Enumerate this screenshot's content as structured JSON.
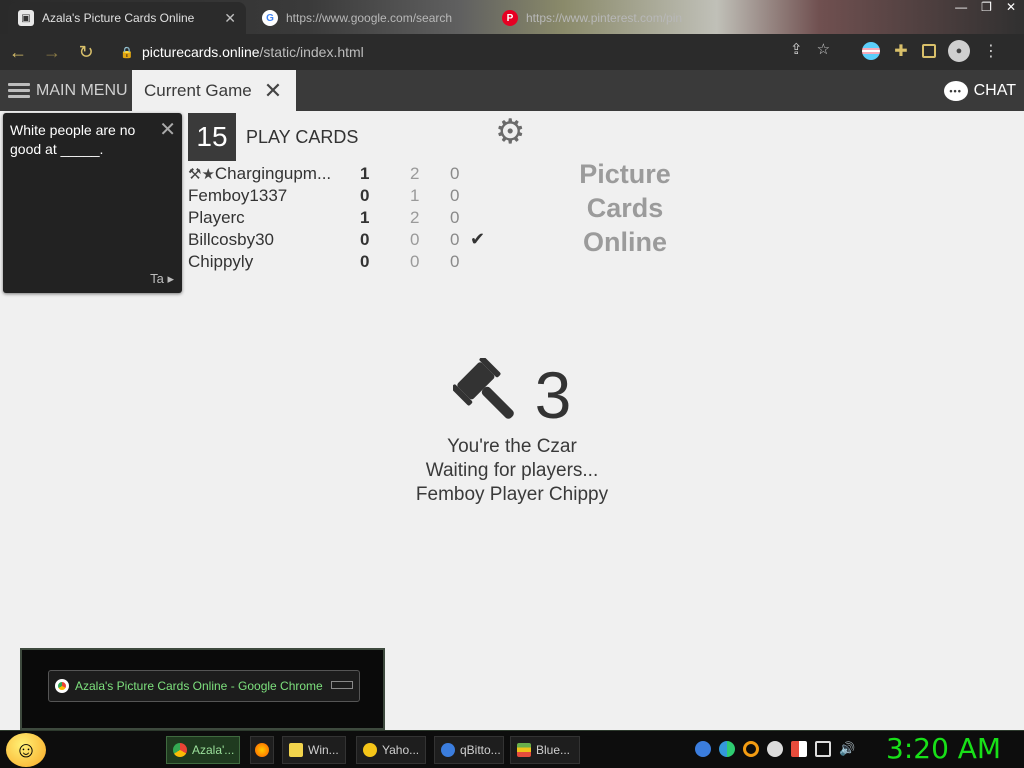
{
  "browser": {
    "tabs": [
      {
        "title": "Azala's Picture Cards Online",
        "active": true
      },
      {
        "title": "https://www.google.com/search",
        "active": false
      },
      {
        "title": "https://www.pinterest.com/pin",
        "active": false
      }
    ],
    "url_host": "picturecards.online",
    "url_path": "/static/index.html"
  },
  "app": {
    "main_menu_label": "MAIN MENU",
    "current_tab_label": "Current Game",
    "chat_label": "CHAT",
    "chat_bubble": "•••"
  },
  "black_card": {
    "text": "White people are no good at _____.",
    "footer": "Ta"
  },
  "game": {
    "round": "15",
    "play_label": "PLAY CARDS",
    "players": [
      {
        "name": "Chargingupm...",
        "score": "1",
        "col2": "2",
        "col3": "0",
        "icons": true,
        "check": false
      },
      {
        "name": "Femboy1337",
        "score": "0",
        "col2": "1",
        "col3": "0",
        "icons": false,
        "check": false
      },
      {
        "name": "Playerc",
        "score": "1",
        "col2": "2",
        "col3": "0",
        "icons": false,
        "check": false
      },
      {
        "name": "Billcosby30",
        "score": "0",
        "col2": "0",
        "col3": "0",
        "icons": false,
        "check": true
      },
      {
        "name": "Chippyly",
        "score": "0",
        "col2": "0",
        "col3": "0",
        "icons": false,
        "check": false
      }
    ]
  },
  "logo": {
    "line1": "Picture",
    "line2": "Cards",
    "line3": "Online"
  },
  "czar": {
    "count": "3",
    "role": "You're the Czar",
    "waiting": "Waiting for players...",
    "pending": "Femboy Player Chippy"
  },
  "thumbnail": {
    "title": "Azala's Picture Cards Online - Google Chrome"
  },
  "taskbar": {
    "items": [
      {
        "label": "Azala'...",
        "active": true,
        "color": "#e0e0e0"
      },
      {
        "label": "Win...",
        "active": false,
        "color": "#f2d44c"
      },
      {
        "label": "Yaho...",
        "active": false,
        "color": "#f5c518"
      },
      {
        "label": "qBitto...",
        "active": false,
        "color": "#3b7ddd"
      },
      {
        "label": "Blue...",
        "active": false,
        "color": "#6ab04c"
      }
    ],
    "clock": "3:20 AM"
  }
}
